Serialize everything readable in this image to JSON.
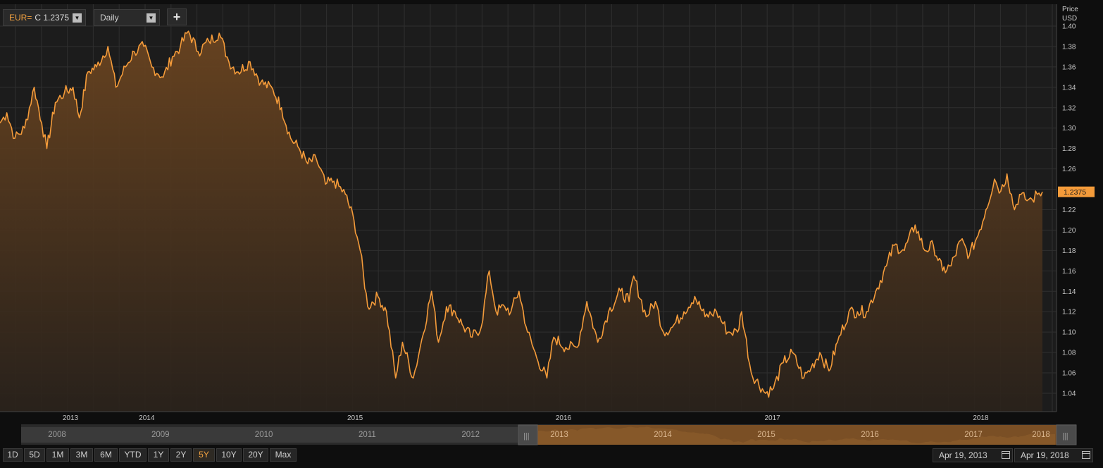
{
  "toolbar": {
    "symbol": "EUR=",
    "quote": "C 1.2375",
    "interval": "Daily",
    "add_label": "+"
  },
  "colors": {
    "line": "#f49b3a",
    "fill_top": "#6a4420",
    "background": "#1c1c1c",
    "grid": "#2f2f2f",
    "price_tag": "#f49b3a"
  },
  "chart_data": {
    "type": "area",
    "yaxis_title": "Price",
    "yaxis_unit": "USD",
    "ylim": [
      1.03,
      1.4
    ],
    "yticks": [
      1.04,
      1.06,
      1.08,
      1.1,
      1.12,
      1.14,
      1.16,
      1.18,
      1.2,
      1.22,
      1.24,
      1.26,
      1.28,
      1.3,
      1.32,
      1.34,
      1.36,
      1.38,
      1.4
    ],
    "xlim": [
      "2013-04-19",
      "2018-04-19"
    ],
    "xticks": [
      {
        "date": "2013-01-01",
        "label": "2013"
      },
      {
        "date": "2014-01-01",
        "label": "2014"
      },
      {
        "date": "2015-01-01",
        "label": "2015"
      },
      {
        "date": "2016-01-01",
        "label": "2016"
      },
      {
        "date": "2017-01-01",
        "label": "2017"
      },
      {
        "date": "2018-01-01",
        "label": "2018"
      }
    ],
    "last_price": "1.2375",
    "grid": true,
    "series": [
      {
        "points": [
          [
            "2013-04-19",
            1.305
          ],
          [
            "2013-05-01",
            1.315
          ],
          [
            "2013-05-15",
            1.29
          ],
          [
            "2013-06-01",
            1.3
          ],
          [
            "2013-06-18",
            1.34
          ],
          [
            "2013-07-01",
            1.305
          ],
          [
            "2013-07-10",
            1.28
          ],
          [
            "2013-07-25",
            1.325
          ],
          [
            "2013-08-10",
            1.335
          ],
          [
            "2013-08-25",
            1.34
          ],
          [
            "2013-09-05",
            1.31
          ],
          [
            "2013-09-20",
            1.355
          ],
          [
            "2013-10-05",
            1.36
          ],
          [
            "2013-10-25",
            1.38
          ],
          [
            "2013-11-08",
            1.34
          ],
          [
            "2013-11-25",
            1.36
          ],
          [
            "2013-12-10",
            1.375
          ],
          [
            "2013-12-27",
            1.38
          ],
          [
            "2014-01-10",
            1.36
          ],
          [
            "2014-01-30",
            1.35
          ],
          [
            "2014-02-15",
            1.37
          ],
          [
            "2014-03-01",
            1.38
          ],
          [
            "2014-03-15",
            1.395
          ],
          [
            "2014-04-01",
            1.375
          ],
          [
            "2014-04-20",
            1.385
          ],
          [
            "2014-05-08",
            1.393
          ],
          [
            "2014-05-25",
            1.365
          ],
          [
            "2014-06-10",
            1.355
          ],
          [
            "2014-07-01",
            1.365
          ],
          [
            "2014-07-20",
            1.345
          ],
          [
            "2014-08-10",
            1.338
          ],
          [
            "2014-08-25",
            1.32
          ],
          [
            "2014-09-10",
            1.29
          ],
          [
            "2014-09-25",
            1.28
          ],
          [
            "2014-10-10",
            1.265
          ],
          [
            "2014-10-25",
            1.27
          ],
          [
            "2014-11-10",
            1.245
          ],
          [
            "2014-11-25",
            1.248
          ],
          [
            "2014-12-15",
            1.235
          ],
          [
            "2014-12-30",
            1.21
          ],
          [
            "2015-01-10",
            1.18
          ],
          [
            "2015-01-23",
            1.125
          ],
          [
            "2015-02-10",
            1.135
          ],
          [
            "2015-02-25",
            1.12
          ],
          [
            "2015-03-13",
            1.055
          ],
          [
            "2015-03-25",
            1.09
          ],
          [
            "2015-04-13",
            1.055
          ],
          [
            "2015-04-25",
            1.085
          ],
          [
            "2015-05-15",
            1.14
          ],
          [
            "2015-05-27",
            1.09
          ],
          [
            "2015-06-10",
            1.125
          ],
          [
            "2015-06-25",
            1.12
          ],
          [
            "2015-07-10",
            1.105
          ],
          [
            "2015-07-25",
            1.095
          ],
          [
            "2015-08-10",
            1.105
          ],
          [
            "2015-08-24",
            1.16
          ],
          [
            "2015-09-05",
            1.12
          ],
          [
            "2015-09-20",
            1.125
          ],
          [
            "2015-10-01",
            1.12
          ],
          [
            "2015-10-15",
            1.14
          ],
          [
            "2015-10-30",
            1.1
          ],
          [
            "2015-11-15",
            1.075
          ],
          [
            "2015-12-03",
            1.055
          ],
          [
            "2015-12-15",
            1.095
          ],
          [
            "2016-01-05",
            1.085
          ],
          [
            "2016-01-25",
            1.085
          ],
          [
            "2016-02-11",
            1.13
          ],
          [
            "2016-03-01",
            1.09
          ],
          [
            "2016-03-20",
            1.12
          ],
          [
            "2016-04-10",
            1.14
          ],
          [
            "2016-04-25",
            1.13
          ],
          [
            "2016-05-03",
            1.155
          ],
          [
            "2016-05-25",
            1.115
          ],
          [
            "2016-06-10",
            1.13
          ],
          [
            "2016-06-24",
            1.1
          ],
          [
            "2016-07-10",
            1.105
          ],
          [
            "2016-07-30",
            1.12
          ],
          [
            "2016-08-18",
            1.135
          ],
          [
            "2016-09-05",
            1.115
          ],
          [
            "2016-09-25",
            1.12
          ],
          [
            "2016-10-15",
            1.1
          ],
          [
            "2016-11-01",
            1.1
          ],
          [
            "2016-11-08",
            1.12
          ],
          [
            "2016-11-25",
            1.06
          ],
          [
            "2016-12-20",
            1.04
          ],
          [
            "2017-01-03",
            1.045
          ],
          [
            "2017-01-20",
            1.07
          ],
          [
            "2017-02-05",
            1.08
          ],
          [
            "2017-02-25",
            1.055
          ],
          [
            "2017-03-10",
            1.065
          ],
          [
            "2017-03-25",
            1.08
          ],
          [
            "2017-04-10",
            1.062
          ],
          [
            "2017-04-25",
            1.09
          ],
          [
            "2017-05-15",
            1.12
          ],
          [
            "2017-05-30",
            1.12
          ],
          [
            "2017-06-15",
            1.12
          ],
          [
            "2017-07-01",
            1.14
          ],
          [
            "2017-07-20",
            1.165
          ],
          [
            "2017-08-02",
            1.185
          ],
          [
            "2017-08-20",
            1.18
          ],
          [
            "2017-09-08",
            1.205
          ],
          [
            "2017-09-25",
            1.18
          ],
          [
            "2017-10-10",
            1.185
          ],
          [
            "2017-10-26",
            1.16
          ],
          [
            "2017-11-10",
            1.165
          ],
          [
            "2017-11-27",
            1.19
          ],
          [
            "2017-12-12",
            1.175
          ],
          [
            "2017-12-30",
            1.2
          ],
          [
            "2018-01-10",
            1.22
          ],
          [
            "2018-01-25",
            1.25
          ],
          [
            "2018-02-05",
            1.238
          ],
          [
            "2018-02-16",
            1.255
          ],
          [
            "2018-03-01",
            1.22
          ],
          [
            "2018-03-10",
            1.235
          ],
          [
            "2018-03-20",
            1.23
          ],
          [
            "2018-04-01",
            1.23
          ],
          [
            "2018-04-10",
            1.235
          ],
          [
            "2018-04-19",
            1.2375
          ]
        ]
      }
    ]
  },
  "navigator": {
    "past_years": [
      "2008",
      "2009",
      "2010",
      "2011",
      "2012"
    ],
    "selected_years": [
      "2013",
      "2014",
      "2015",
      "2016",
      "2017",
      "2018"
    ]
  },
  "range_buttons": [
    "1D",
    "5D",
    "1M",
    "3M",
    "6M",
    "YTD",
    "1Y",
    "2Y",
    "5Y",
    "10Y",
    "20Y",
    "Max"
  ],
  "active_range": "5Y",
  "date_range": {
    "from": "Apr 19, 2013",
    "to": "Apr 19, 2018"
  }
}
